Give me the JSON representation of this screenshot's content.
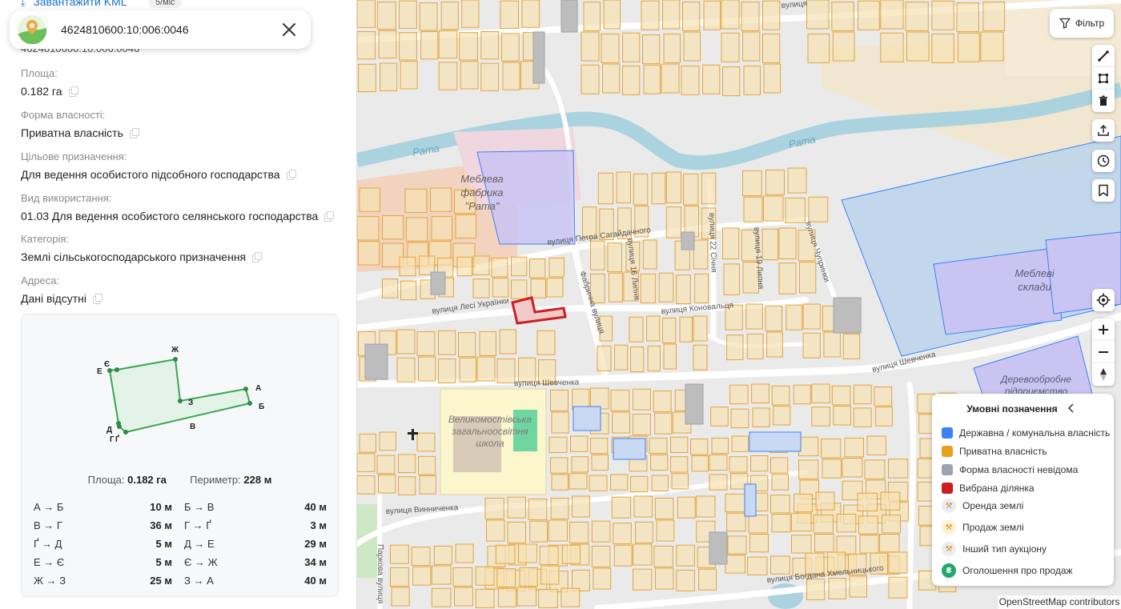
{
  "panel": {
    "download_kml": "Завантажити KML",
    "download_price": "5/міс",
    "cadastral_number_scrolled": "4624810600:10:006:0046",
    "search": {
      "cadastral_number": "4624810600:10:006:0046"
    },
    "fields": [
      {
        "label": "Площа:",
        "value": "0.182 га"
      },
      {
        "label": "Форма власності:",
        "value": "Приватна власність"
      },
      {
        "label": "Цільове призначення:",
        "value": "Для ведення особистого підсобного господарства"
      },
      {
        "label": "Вид використання:",
        "value": "01.03 Для ведення особистого селянського господарства"
      },
      {
        "label": "Категорія:",
        "value": "Землі сільськогосподарського призначення"
      },
      {
        "label": "Адреса:",
        "value": "Дані відсутні"
      }
    ],
    "shape": {
      "vertices": [
        "А",
        "Б",
        "В",
        "Г",
        "Ґ",
        "Д",
        "Е",
        "Є",
        "Ж",
        "З"
      ],
      "area_label": "Площа:",
      "area_value": "0.182 га",
      "perimeter_label": "Периметр:",
      "perimeter_value": "228 м",
      "segments": [
        {
          "name": "А → Б",
          "len": "10 м"
        },
        {
          "name": "Б → В",
          "len": "40 м"
        },
        {
          "name": "В → Г",
          "len": "36 м"
        },
        {
          "name": "Г → Ґ",
          "len": "3 м"
        },
        {
          "name": "Ґ → Д",
          "len": "5 м"
        },
        {
          "name": "Д → Е",
          "len": "29 м"
        },
        {
          "name": "Е → Є",
          "len": "5 м"
        },
        {
          "name": "Є → Ж",
          "len": "34 м"
        },
        {
          "name": "Ж → З",
          "len": "25 м"
        },
        {
          "name": "З → А",
          "len": "40 м"
        }
      ]
    }
  },
  "map": {
    "filter_label": "Фільтр",
    "tools": [
      "measure-line-icon",
      "measure-area-icon",
      "trash-icon",
      "upload-icon",
      "history-icon",
      "bookmark-icon",
      "locate-icon",
      "zoom-in-icon",
      "zoom-out-icon",
      "compass-icon"
    ],
    "labels": {
      "river1": "Рата",
      "river2": "Рата",
      "factory": [
        "Меблева",
        "фабрика",
        "\"Рата\""
      ],
      "warehouse": [
        "Меблеві",
        "склади"
      ],
      "woodworking": [
        "Деревообробне",
        "підприємство"
      ],
      "school": [
        "Великомостівська",
        "загальноосвітня",
        "школа"
      ],
      "streets": {
        "sahaidachnoho": "вулиця Петра Сагайдачного",
        "lesi": "вулиця Лесі Українки",
        "konovaltsia": "вулиця Коновальця",
        "shevchenka_w": "вулиця Шевченка",
        "shevchenka_e": "вулиця Шевченка",
        "fabrychna": "Фабрична вулиця",
        "lypnia16": "вулиця 16 Липня",
        "sichnia22": "вулиця 22 Січня",
        "lypnia19": "вулиця 19 Липня",
        "chupryny": "вулиця Чупринки",
        "vynnychenka": "вулиця Винниченка",
        "khmelnytskoho": "вулиця Богдана Хмельницького",
        "parkova": "Паркова вулиця",
        "top": "вулиця"
      }
    },
    "legend": {
      "title": "Умовні позначення",
      "items": [
        {
          "label": "Державна / комунальна власність",
          "color": "#3b82f6"
        },
        {
          "label": "Приватна власність",
          "color": "#e6a21a"
        },
        {
          "label": "Форма власності невідома",
          "color": "#9ca3af"
        },
        {
          "label": "Вибрана ділянка",
          "color": "#cc1f1f"
        }
      ],
      "auction": [
        {
          "label": "Оренда землі",
          "icon": "rent-auction-icon"
        },
        {
          "label": "Продаж землі",
          "icon": "sale-auction-icon"
        },
        {
          "label": "Інший тип аукціону",
          "icon": "other-auction-icon"
        },
        {
          "label": "Оголошення про продаж",
          "icon": "hryvnia-icon"
        }
      ]
    },
    "attribution": "OpenStreetMap contributors"
  }
}
